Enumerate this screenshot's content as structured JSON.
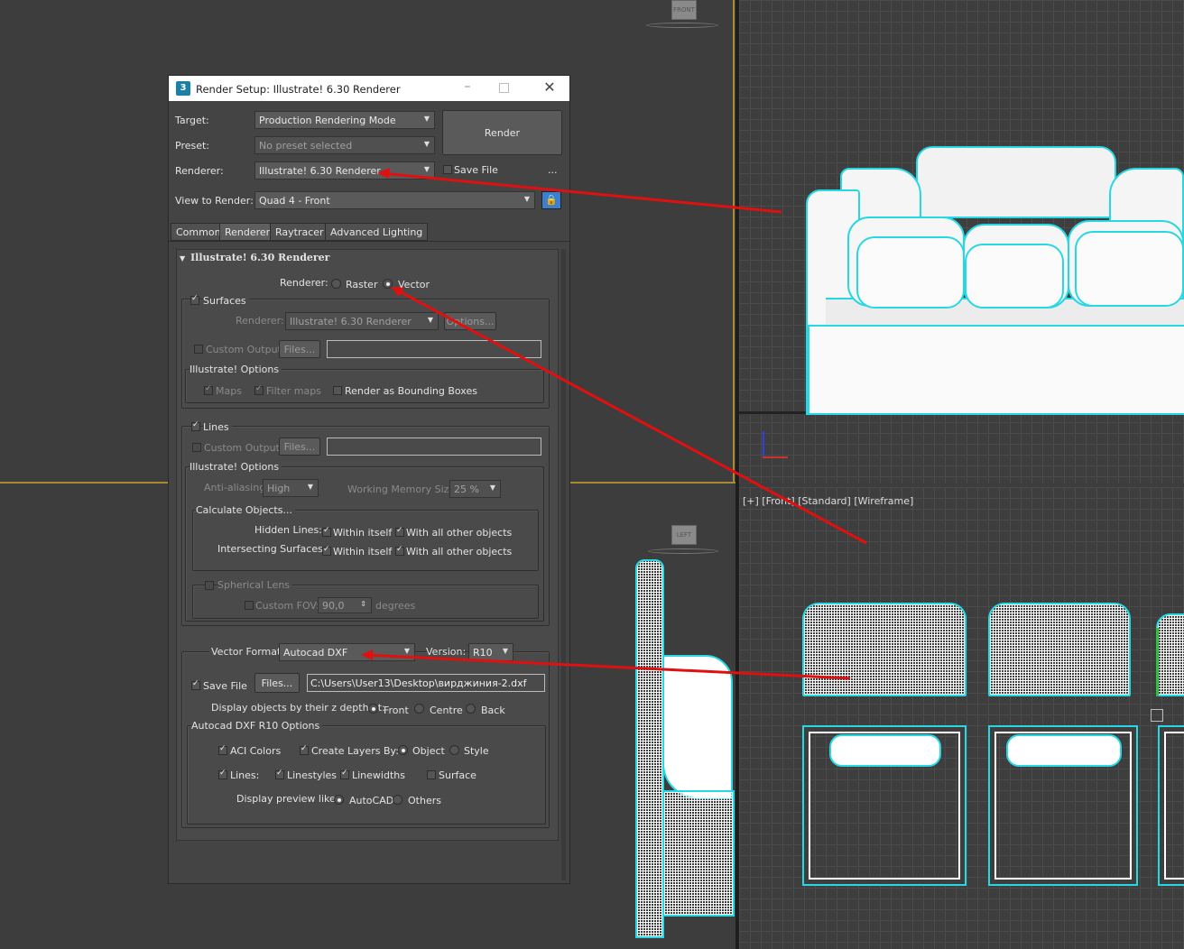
{
  "dialog": {
    "title": "Render Setup: Illustrate! 6.30  Renderer",
    "target_label": "Target:",
    "target_value": "Production Rendering Mode",
    "preset_label": "Preset:",
    "preset_value": "No preset selected",
    "renderer_label": "Renderer:",
    "renderer_value": "Illustrate! 6.30  Renderer",
    "render_button": "Render",
    "save_file_label": "Save File",
    "more_label": "...",
    "view_label": "View to Render:",
    "view_value": "Quad 4 - Front",
    "tabs": [
      "Common",
      "Renderer",
      "Raytracer",
      "Advanced Lighting"
    ],
    "rollout_title": "Illustrate! 6.30  Renderer",
    "mode_label": "Renderer:",
    "mode_raster": "Raster",
    "mode_vector": "Vector",
    "surfaces": {
      "label": "Surfaces",
      "renderer_label": "Renderer:",
      "renderer_value": "Illustrate! 6.30  Renderer",
      "options_button": "Options...",
      "custom_output_label": "Custom Output:",
      "files_button": "Files...",
      "options_title": "Illustrate! Options",
      "maps_label": "Maps",
      "filter_maps_label": "Filter maps",
      "bbox_label": "Render as Bounding Boxes"
    },
    "lines": {
      "label": "Lines",
      "custom_output_label": "Custom Output:",
      "files_button": "Files...",
      "options_title": "Illustrate! Options",
      "aa_label": "Anti-aliasing:",
      "aa_value": "High",
      "wms_label": "Working Memory Size:",
      "wms_value": "25 %",
      "calc_title": "Calculate Objects...",
      "hidden_label": "Hidden Lines:",
      "intersect_label": "Intersecting Surfaces:",
      "within_label": "Within itself",
      "all_label": "With all other objects",
      "spherical_label": "Spherical Lens",
      "fov_label": "Custom FOV:",
      "fov_value": "90,0",
      "degrees_label": "degrees"
    },
    "vector": {
      "format_label": "Vector Format:",
      "format_value": "Autocad DXF",
      "version_label": "Version:",
      "version_value": "R10",
      "save_file_label": "Save File",
      "files_button": "Files...",
      "path_value": "C:\\Users\\User13\\Desktop\\вирджиния-2.dxf",
      "zdepth_label": "Display objects by their z depth at:",
      "front": "Front",
      "centre": "Centre",
      "back": "Back",
      "dxf_title": "Autocad DXF R10 Options",
      "aci_label": "ACI Colors",
      "create_layers_label": "Create Layers By:",
      "object_label": "Object",
      "style_label": "Style",
      "lines_label": "Lines:",
      "linestyles_label": "Linestyles",
      "linewidths_label": "Linewidths",
      "surface_label": "Surface",
      "preview_label": "Display preview like:",
      "autocad_label": "AutoCAD",
      "others_label": "Others"
    }
  },
  "viewports": {
    "front_label": "[+] [Front] [Standard] [Wireframe]",
    "cube_front": "FRONT",
    "cube_left": "LEFT"
  },
  "colors": {
    "accent": "#27d8e4",
    "arrow": "#e01010",
    "viewport_border": "#c8a030"
  }
}
